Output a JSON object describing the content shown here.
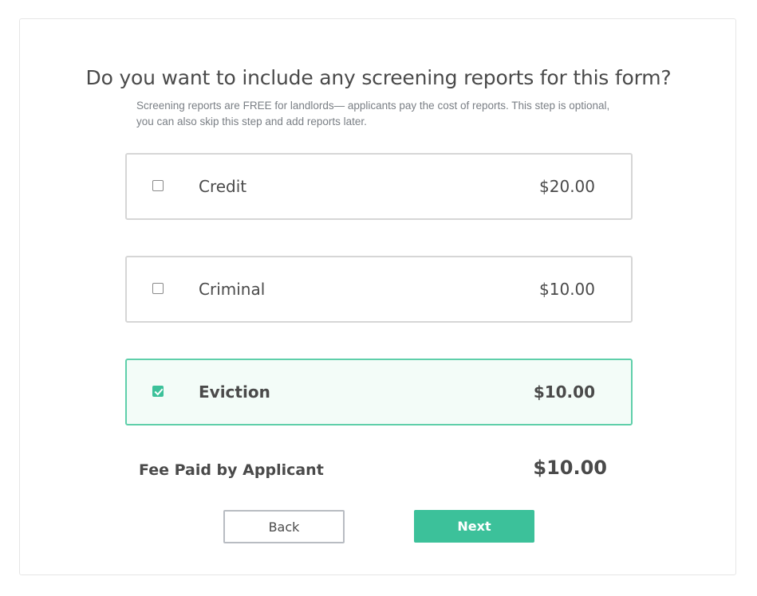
{
  "header": {
    "title": "Do you want to include any screening reports for this form?",
    "subtitle": "Screening reports are FREE for landlords— applicants pay the cost of reports. This step is optional, you can also skip this step and add reports later."
  },
  "options": [
    {
      "name": "Credit",
      "price": "$20.00",
      "checked": false
    },
    {
      "name": "Criminal",
      "price": "$10.00",
      "checked": false
    },
    {
      "name": "Eviction",
      "price": "$10.00",
      "checked": true
    }
  ],
  "fee": {
    "label": "Fee Paid by Applicant",
    "value": "$10.00"
  },
  "actions": {
    "back_label": "Back",
    "next_label": "Next"
  },
  "colors": {
    "accent": "#3cc19a",
    "selected_border": "#5fcfaa",
    "selected_bg": "#f3fcf8"
  },
  "icons": {
    "unchecked": "checkbox-unchecked-icon",
    "checked": "checkbox-checked-icon"
  }
}
